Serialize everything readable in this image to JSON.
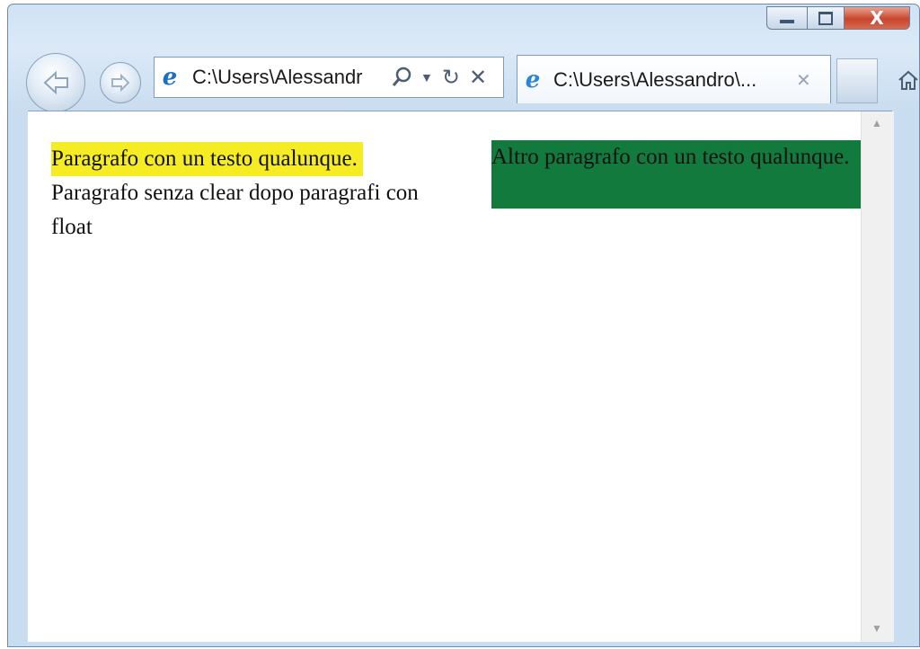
{
  "window": {
    "address_bar": {
      "text": "C:\\Users\\Alessandr"
    },
    "tab": {
      "title": "C:\\Users\\Alessandro\\...",
      "close_glyph": "✕"
    },
    "caption_buttons": {
      "minimize_icon": "minimize-icon",
      "maximize_icon": "maximize-icon",
      "close_label": "X"
    }
  },
  "page": {
    "paragraph_yellow": "Paragrafo con un testo qualunque.",
    "paragraph_green": "Altro paragrafo con un testo qualunque.",
    "paragraph_plain": "Paragrafo senza clear dopo paragrafi con float"
  },
  "colors": {
    "yellow_bg": "#f5ec23",
    "green_bg": "#127a3d"
  }
}
